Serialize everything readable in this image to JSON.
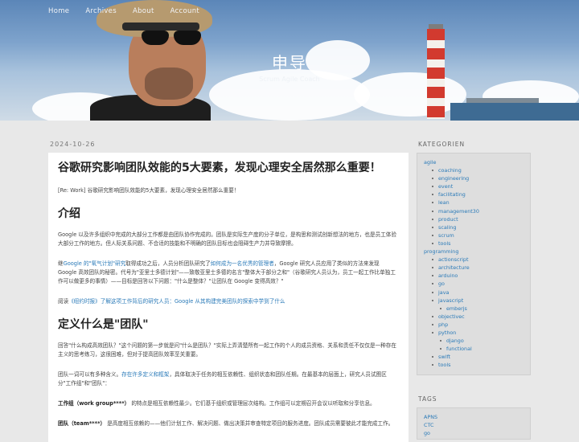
{
  "nav": [
    "Home",
    "Archives",
    "About",
    "Account"
  ],
  "site": {
    "title": "申导",
    "subtitle": "Scrum Agile Coach"
  },
  "post": {
    "date": "2024-10-26",
    "title": "谷歌研究影响团队效能的5大要素，发现心理安全居然那么重要！",
    "intro": "[Re: Work] 谷歌研究影响团队效能的5大要素，发现心理安全居然那么重要！",
    "h_intro": "介绍",
    "p1": "Google 以及许多组织中完成的大部分工作都是由团队协作完成的。团队是实际生产度的分子单位，是构思和测试创新想法的地方，也是员工体验大部分工作的地方。但人际关系问题、不合适的技能和不明确的团队目标也会阻碍生产力并导致摩擦。",
    "p2_a": "继",
    "p2_link1": "Google 的\"氧气计划\"研究",
    "p2_b": "取得成功之后，人员分析团队研究了",
    "p2_link2": "如何成为一名优秀的管理者",
    "p2_c": "，Google 研究人员应用了类似的方法来发现 Google 高效团队的秘密。代号为\"亚里士多德计划\"——致敬亚里士多德的名言\"整体大于部分之和\"（谷歌研究人员认为，员工一起工作比单独工作可以做更多的事情）——目标是回答以下问题：\"什么是整体？\"让团队在 Google 变得高效？\"",
    "p3_a": "阅读",
    "p3_link": "《纽约时报》了解这项工作背后的研究人员：Google 从其构建完美团队的探索中学到了什么",
    "h_team": "定义什么是\"团队\"",
    "p4": "回答\"什么构成高效团队？\"这个问题的第一步就是问\"什么是团队？\"实际上弄清楚所有一起工作的个人的成员资格、关系和责任不仅仅是一种存在主义的思考练习，这很困难，但对于提高团队效率至关重要。",
    "p5_a": "团队一词可以有多种含义。",
    "p5_link": "存在许多定义和框架",
    "p5_b": "，具体取决于任务的相互依赖性、组织状态和团队任期。在最基本的层面上，研究人员试图区分\"工作组\"和\"团队\"：",
    "p6_b": "工作组（work group****）",
    "p6_t": "的特点是相互依赖性最少。它们基于组织或管理层次结构。工作组可以定期召开会议以听取和分享信息。",
    "p7_b": "团队（team****）",
    "p7_t": "是高度相互依赖的——他们计划工作、解决问题、做出决策并审查特定项目的服务进度。团队成员需要彼此才能完成工作。"
  },
  "sidebar": {
    "categories_heading": "KATEGORIEN",
    "categories": [
      {
        "label": "agile",
        "level": 0
      },
      {
        "label": "coaching",
        "level": 1
      },
      {
        "label": "engineering",
        "level": 1
      },
      {
        "label": "event",
        "level": 1
      },
      {
        "label": "facilitating",
        "level": 1
      },
      {
        "label": "lean",
        "level": 1
      },
      {
        "label": "management30",
        "level": 1
      },
      {
        "label": "product",
        "level": 1
      },
      {
        "label": "scaling",
        "level": 1
      },
      {
        "label": "scrum",
        "level": 1
      },
      {
        "label": "tools",
        "level": 1
      },
      {
        "label": "programming",
        "level": 0
      },
      {
        "label": "actionscript",
        "level": 1
      },
      {
        "label": "architecture",
        "level": 1
      },
      {
        "label": "arduino",
        "level": 1
      },
      {
        "label": "go",
        "level": 1
      },
      {
        "label": "java",
        "level": 1
      },
      {
        "label": "javascript",
        "level": 1
      },
      {
        "label": "emberjs",
        "level": 2
      },
      {
        "label": "objectivec",
        "level": 1
      },
      {
        "label": "php",
        "level": 1
      },
      {
        "label": "python",
        "level": 1
      },
      {
        "label": "django",
        "level": 2
      },
      {
        "label": "functional",
        "level": 2
      },
      {
        "label": "swift",
        "level": 1
      },
      {
        "label": "tools",
        "level": 1
      }
    ],
    "tags_heading": "TAGS",
    "tags": [
      "APNS",
      "CTC",
      "go"
    ]
  }
}
